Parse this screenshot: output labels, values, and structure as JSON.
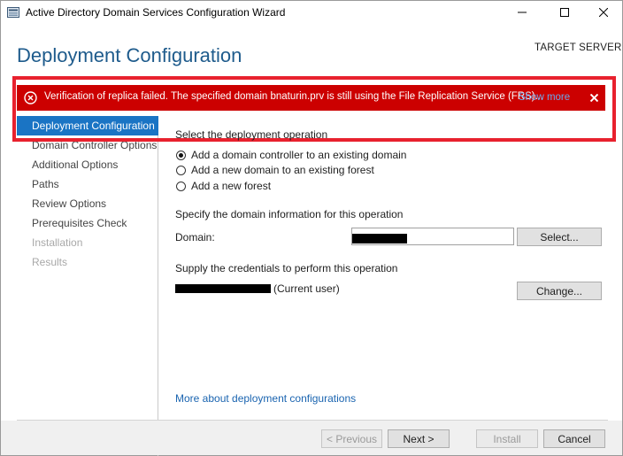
{
  "window": {
    "title": "Active Directory Domain Services Configuration Wizard"
  },
  "header": {
    "page_title": "Deployment Configuration",
    "target_server": "TARGET SERVER"
  },
  "error": {
    "message": "Verification of replica failed. The specified domain bnaturin.prv is still using the File Replication Service (FRS)...",
    "show_more": "Show more",
    "close": "×"
  },
  "sidebar": {
    "items": [
      {
        "label": "Deployment Configuration",
        "state": "active"
      },
      {
        "label": "Domain Controller Options",
        "state": "normal"
      },
      {
        "label": "Additional Options",
        "state": "normal"
      },
      {
        "label": "Paths",
        "state": "normal"
      },
      {
        "label": "Review Options",
        "state": "normal"
      },
      {
        "label": "Prerequisites Check",
        "state": "normal"
      },
      {
        "label": "Installation",
        "state": "disabled"
      },
      {
        "label": "Results",
        "state": "disabled"
      }
    ]
  },
  "operation": {
    "heading": "Select the deployment operation",
    "options": [
      {
        "label": "Add a domain controller to an existing domain",
        "selected": true
      },
      {
        "label": "Add a new domain to an existing forest",
        "selected": false
      },
      {
        "label": "Add a new forest",
        "selected": false
      }
    ]
  },
  "domain_info": {
    "heading": "Specify the domain information for this operation",
    "domain_label": "Domain:",
    "select_button": "Select..."
  },
  "credentials": {
    "heading": "Supply the credentials to perform this operation",
    "current_user_suffix": "(Current user)",
    "change_button": "Change..."
  },
  "more_link": "More about deployment configurations",
  "footer": {
    "previous": "< Previous",
    "next": "Next >",
    "install": "Install",
    "cancel": "Cancel"
  },
  "colors": {
    "error_banner": "#cc0000",
    "highlight_border": "#e8212e",
    "active_nav": "#1a74c4",
    "title_blue": "#1e5b8c",
    "link": "#1a64b0"
  }
}
